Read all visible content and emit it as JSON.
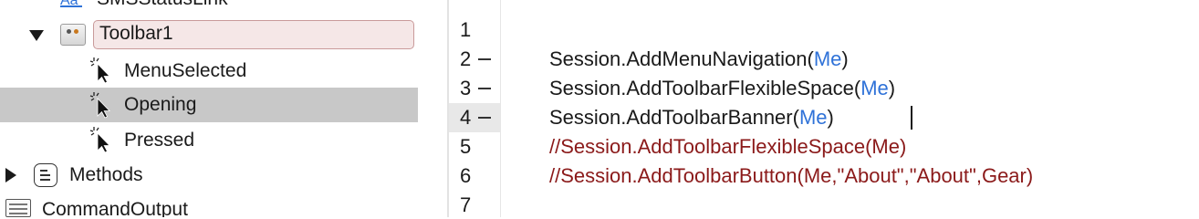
{
  "navigator": {
    "top_partial_item": "SMSStatusLink",
    "toolbar_item": "Toolbar1",
    "events": [
      {
        "label": "MenuSelected",
        "selected": false
      },
      {
        "label": "Opening",
        "selected": true
      },
      {
        "label": "Pressed",
        "selected": false
      }
    ],
    "methods_label": "Methods",
    "bottom_partial_item": "CommandOutput"
  },
  "editor": {
    "line_numbers": [
      "1",
      "2",
      "3",
      "4",
      "5",
      "6",
      "7"
    ],
    "current_line": "4",
    "lines": [
      {
        "text": ""
      },
      {
        "prefix": "Session.AddMenuNavigation(",
        "kw": "Me",
        "suffix": ")"
      },
      {
        "prefix": "Session.AddToolbarFlexibleSpace(",
        "kw": "Me",
        "suffix": ")"
      },
      {
        "prefix": "Session.AddToolbarBanner(",
        "kw": "Me",
        "suffix": ")"
      },
      {
        "comment": "//Session.AddToolbarFlexibleSpace(Me)"
      },
      {
        "comment": "//Session.AddToolbarButton(Me,\"About\",\"About\",Gear)"
      },
      {
        "text": ""
      }
    ]
  },
  "colors": {
    "keyword": "#2f72d8",
    "comment": "#8b1a1a",
    "selection": "#c8c8c8",
    "field_bg": "#f5e7e7"
  }
}
